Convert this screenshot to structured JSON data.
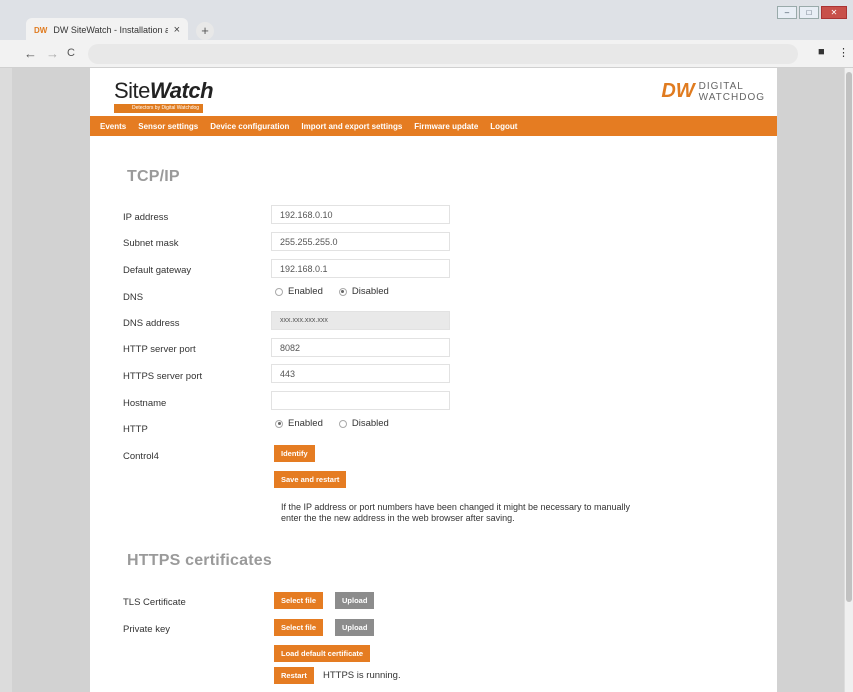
{
  "browser": {
    "tab_favicon": "DW",
    "tab_title": "DW SiteWatch - Installation and",
    "tab_close": "×",
    "new_tab": "+",
    "back": "←",
    "forward": "→",
    "reload": "C",
    "menu": "⋮"
  },
  "header": {
    "logo_site": "Site",
    "logo_watch": "Watch",
    "logo_tagline": "Detectors by Digital Watchdog",
    "brand_mark": "DW",
    "brand_line1": "DIGITAL",
    "brand_line2": "WATCHDOG"
  },
  "menu": [
    "Events",
    "Sensor settings",
    "Device configuration",
    "Import and export settings",
    "Firmware update",
    "Logout"
  ],
  "tcpip": {
    "title": "TCP/IP",
    "ip_label": "IP address",
    "ip_value": "192.168.0.10",
    "subnet_label": "Subnet mask",
    "subnet_value": "255.255.255.0",
    "gateway_label": "Default gateway",
    "gateway_value": "192.168.0.1",
    "dns_label": "DNS",
    "dns_enabled": "Enabled",
    "dns_disabled": "Disabled",
    "dns_address_label": "DNS address",
    "dns_address_value": "xxx.xxx.xxx.xxx",
    "http_port_label": "HTTP server port",
    "http_port_value": "8082",
    "https_port_label": "HTTPS server port",
    "https_port_value": "443",
    "hostname_label": "Hostname",
    "hostname_value": "",
    "http_label": "HTTP",
    "http_enabled": "Enabled",
    "http_disabled": "Disabled",
    "control4_label": "Control4",
    "identify_button": "Identify",
    "save_button": "Save and restart",
    "note": "If the IP address or port numbers have been changed it might be necessary to manually enter the the new address in the web browser after saving."
  },
  "https": {
    "title": "HTTPS certificates",
    "tls_label": "TLS Certificate",
    "key_label": "Private key",
    "select_file": "Select file",
    "upload": "Upload",
    "load_default": "Load default certificate",
    "restart": "Restart",
    "status": "HTTPS is running."
  }
}
